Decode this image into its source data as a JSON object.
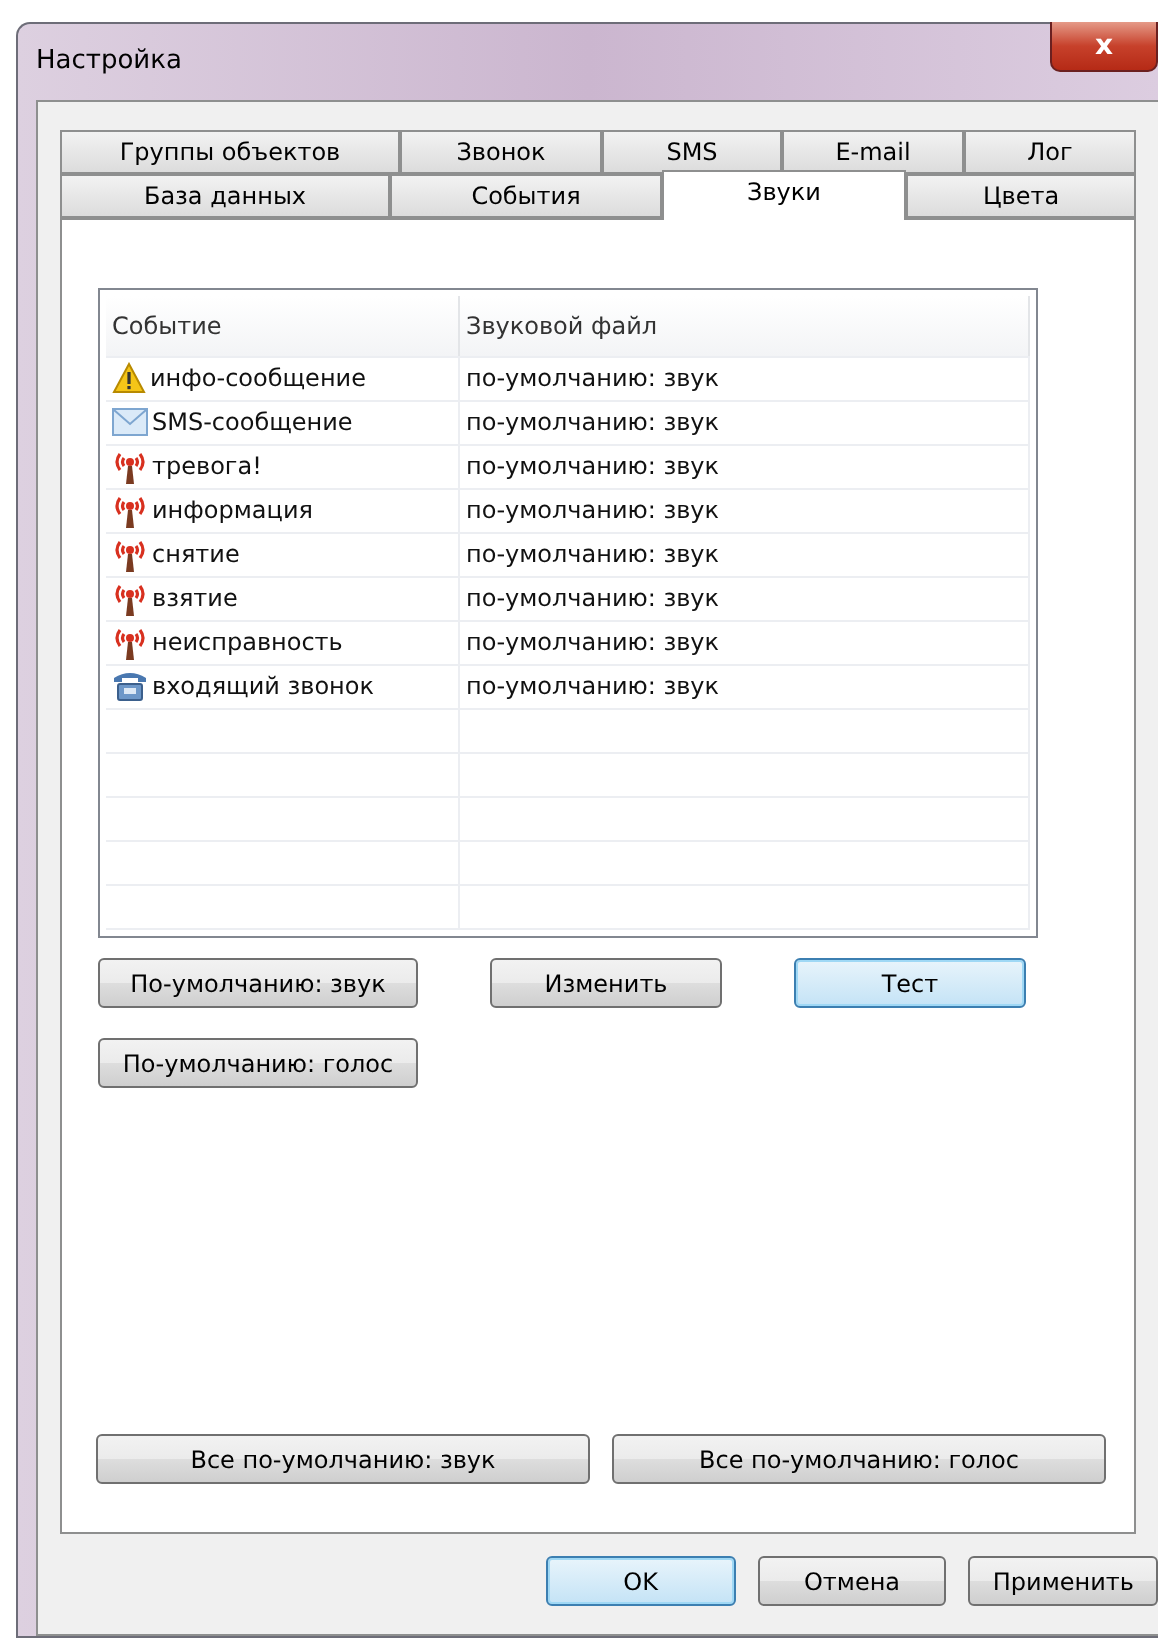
{
  "window": {
    "title": "Настройка",
    "close": "x"
  },
  "tab_rows": [
    [
      {
        "label": "Группы объектов",
        "selected": false
      },
      {
        "label": "Звонок",
        "selected": false
      },
      {
        "label": "SMS",
        "selected": false
      },
      {
        "label": "E-mail",
        "selected": false
      },
      {
        "label": "Лог",
        "selected": false
      }
    ],
    [
      {
        "label": "База данных",
        "selected": false
      },
      {
        "label": "События",
        "selected": false
      },
      {
        "label": "Звуки",
        "selected": true
      },
      {
        "label": "Цвета",
        "selected": false
      }
    ]
  ],
  "table": {
    "columns": [
      "Событие",
      "Звуковой файл"
    ],
    "rows": [
      {
        "kind": "warning",
        "event": "инфо-сообщение",
        "file": "по-умолчанию: звук"
      },
      {
        "kind": "sms",
        "event": "SMS-сообщение",
        "file": "по-умолчанию: звук"
      },
      {
        "kind": "alarm",
        "event": "тревога!",
        "file": "по-умолчанию: звук"
      },
      {
        "kind": "alarm",
        "event": "информация",
        "file": "по-умолчанию: звук"
      },
      {
        "kind": "alarm",
        "event": "снятие",
        "file": "по-умолчанию: звук"
      },
      {
        "kind": "alarm",
        "event": "взятие",
        "file": "по-умолчанию: звук"
      },
      {
        "kind": "alarm",
        "event": "неисправность",
        "file": "по-умолчанию: звук"
      },
      {
        "kind": "call",
        "event": "входящий звонок",
        "file": "по-умолчанию: звук"
      }
    ]
  },
  "sound_buttons": [
    {
      "label": "По-умолчанию: звук",
      "default": false
    },
    {
      "label": "Изменить",
      "default": false
    },
    {
      "label": "Тест",
      "default": true
    }
  ],
  "voice_button": {
    "label": "По-умолчанию: голос",
    "default": false
  },
  "all_buttons": [
    {
      "label": "Все по-умолчанию: звук",
      "default": false
    },
    {
      "label": "Все по-умолчанию: голос",
      "default": false
    }
  ],
  "dialog_buttons": [
    {
      "label": "OK",
      "default": true
    },
    {
      "label": "Отмена",
      "default": false
    },
    {
      "label": "Применить",
      "default": false
    }
  ]
}
